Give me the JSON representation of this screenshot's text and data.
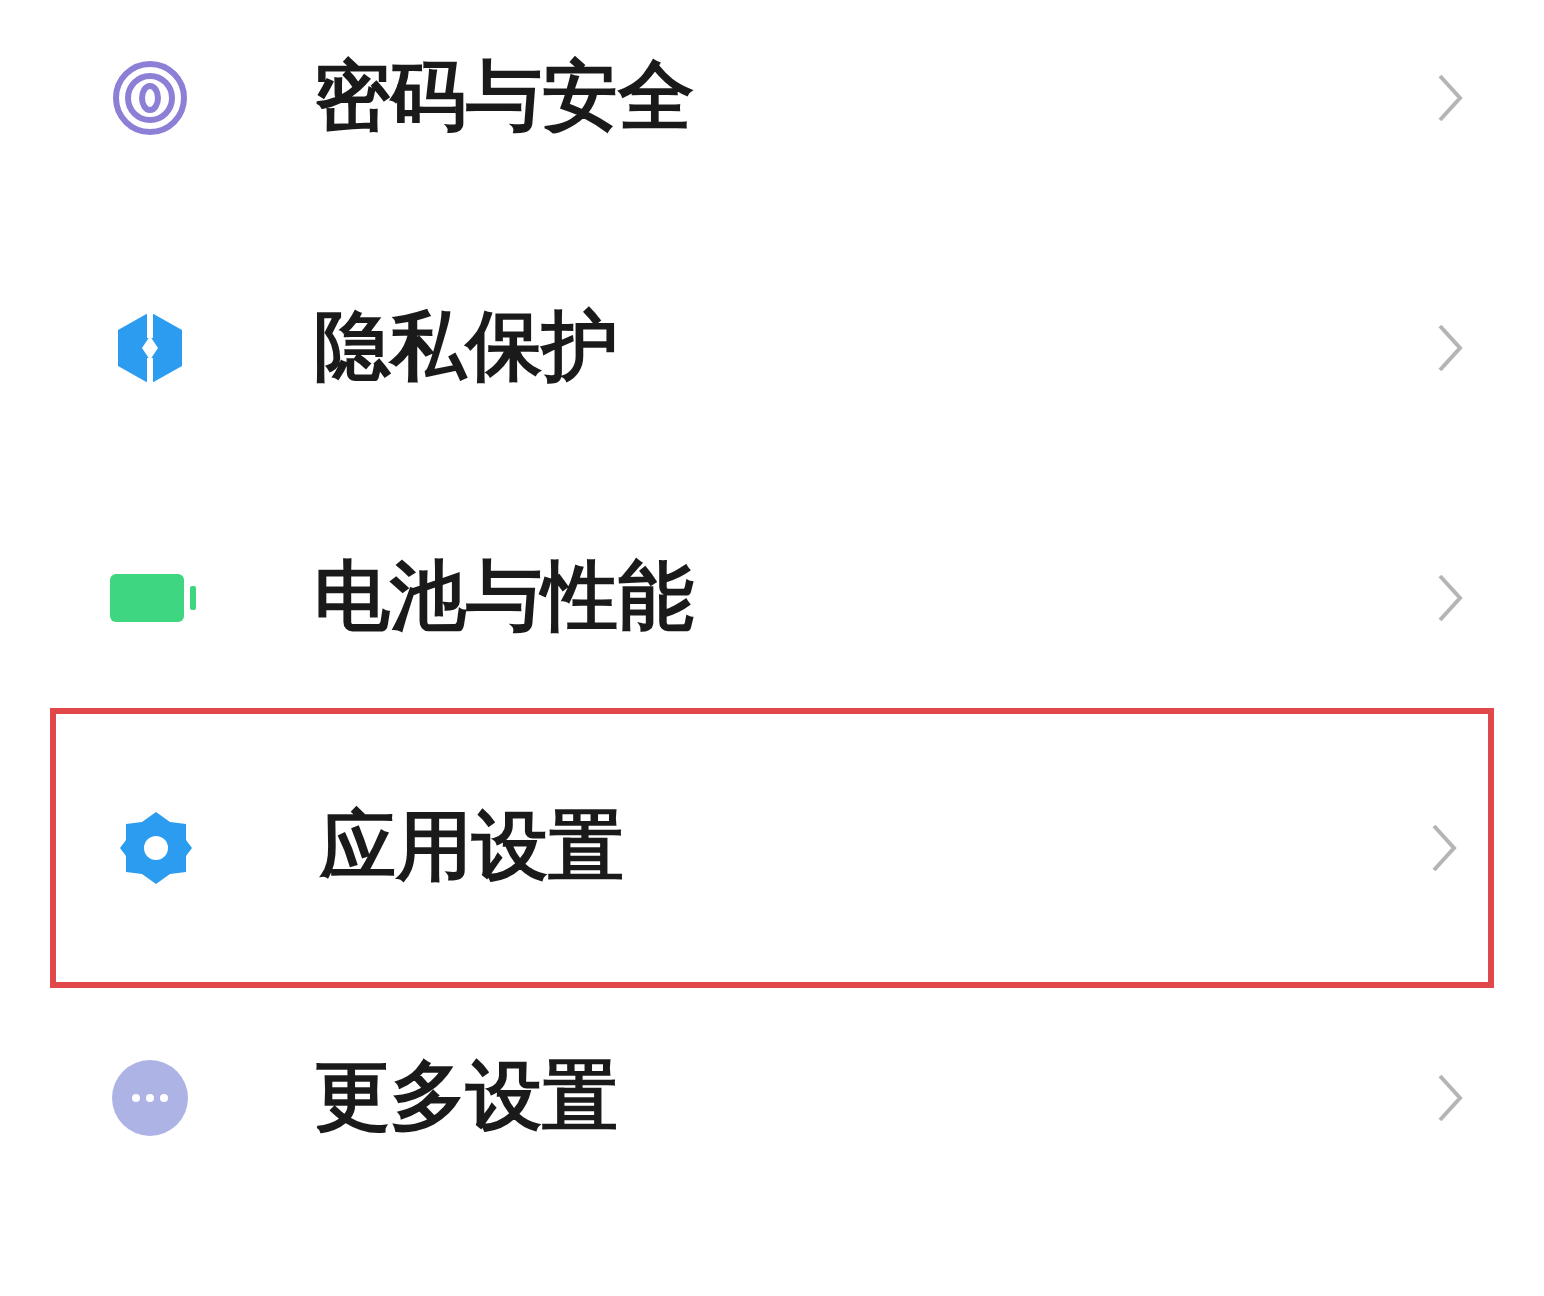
{
  "settings_items": [
    {
      "kind": "fingerprint",
      "label": "密码与安全",
      "highlighted": false
    },
    {
      "kind": "shield",
      "label": "隐私保护",
      "highlighted": false
    },
    {
      "kind": "battery",
      "label": "电池与性能",
      "highlighted": false
    },
    {
      "kind": "gear",
      "label": "应用设置",
      "highlighted": true
    },
    {
      "kind": "more",
      "label": "更多设置",
      "highlighted": false
    }
  ]
}
